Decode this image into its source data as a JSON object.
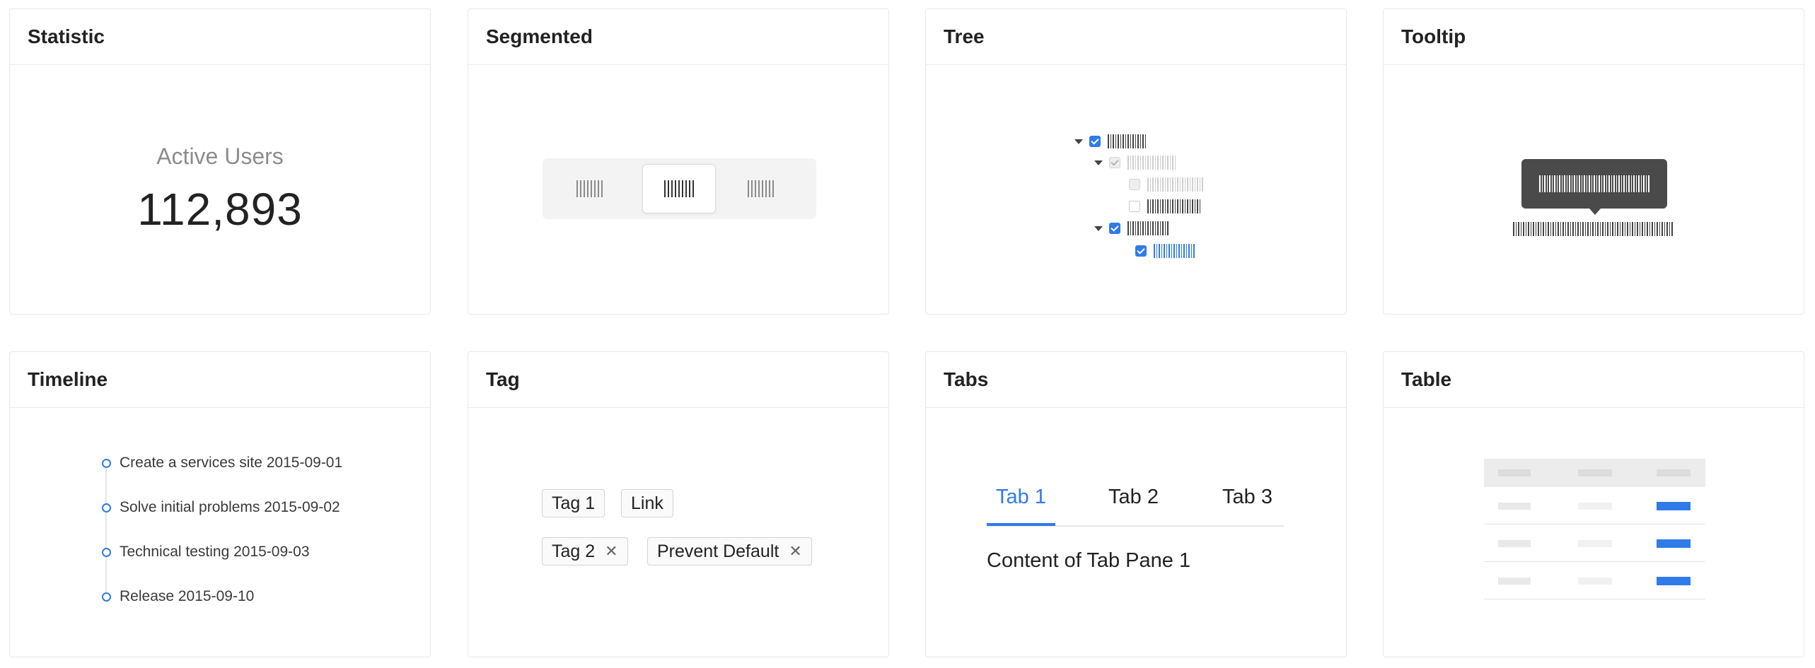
{
  "statistic": {
    "header": "Statistic",
    "title": "Active Users",
    "value": "112,893"
  },
  "segmented": {
    "header": "Segmented",
    "options": 3,
    "selected_index": 1
  },
  "tree": {
    "header": "Tree"
  },
  "tooltip": {
    "header": "Tooltip"
  },
  "timeline": {
    "header": "Timeline",
    "items": [
      "Create a services site 2015-09-01",
      "Solve initial problems 2015-09-02",
      "Technical testing 2015-09-03",
      "Release 2015-09-10"
    ]
  },
  "tag": {
    "header": "Tag",
    "tags": [
      {
        "label": "Tag 1",
        "closable": false
      },
      {
        "label": "Link",
        "closable": false
      },
      {
        "label": "Tag 2",
        "closable": true
      },
      {
        "label": "Prevent Default",
        "closable": true
      }
    ],
    "close_glyph": "✕"
  },
  "tabs": {
    "header": "Tabs",
    "items": [
      "Tab 1",
      "Tab 2",
      "Tab 3"
    ],
    "active_index": 0,
    "content": "Content of Tab Pane 1"
  },
  "table": {
    "header": "Table"
  },
  "colors": {
    "accent": "#2f7be8",
    "tooltip_bg": "#4a4a4a"
  }
}
